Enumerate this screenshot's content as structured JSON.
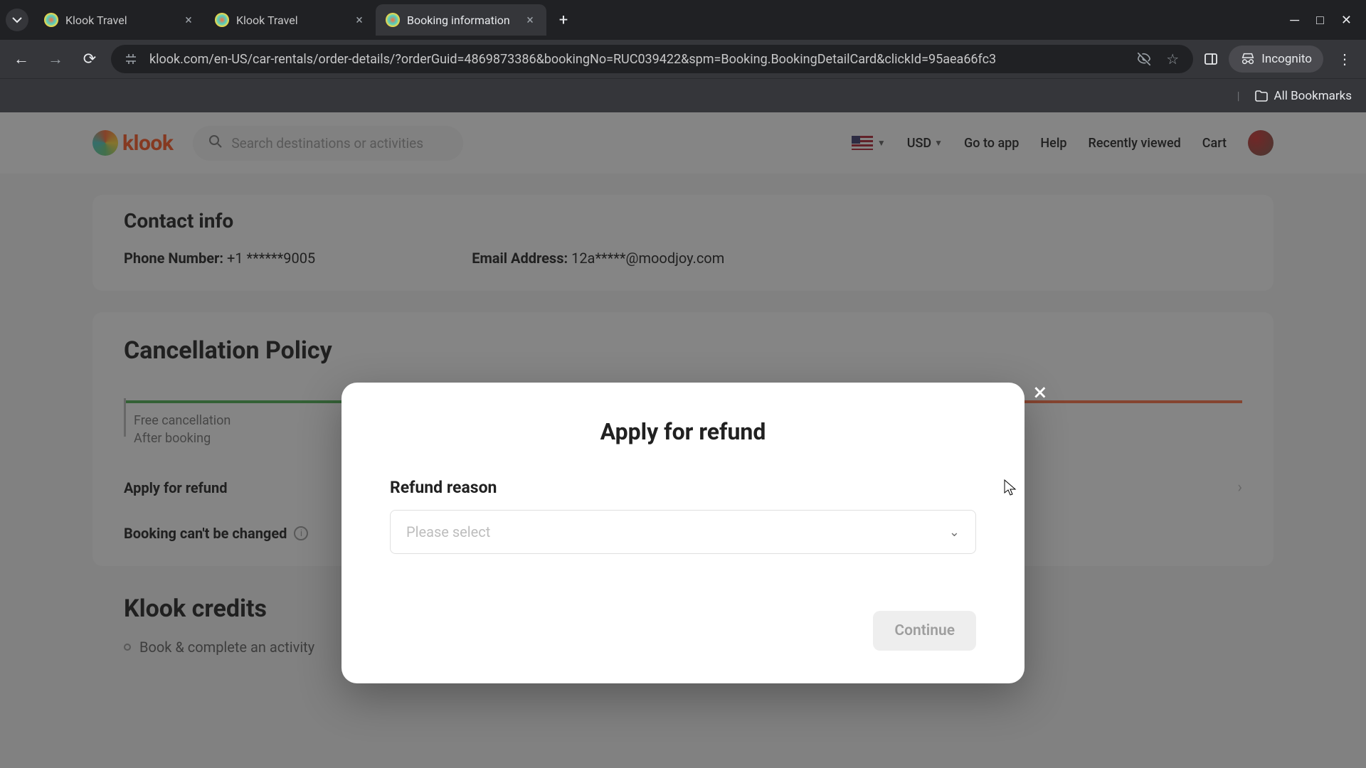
{
  "browser": {
    "tabs": [
      {
        "title": "Klook Travel",
        "active": false
      },
      {
        "title": "Klook Travel",
        "active": false
      },
      {
        "title": "Booking information",
        "active": true
      }
    ],
    "url": "klook.com/en-US/car-rentals/order-details/?orderGuid=4869873386&bookingNo=RUC039422&spm=Booking.BookingDetailCard&clickId=95aea66fc3",
    "incognito_label": "Incognito",
    "all_bookmarks": "All Bookmarks"
  },
  "header": {
    "logo_text": "klook",
    "search_placeholder": "Search destinations or activities",
    "currency": "USD",
    "links": {
      "go_to_app": "Go to app",
      "help": "Help",
      "recently_viewed": "Recently viewed",
      "cart": "Cart"
    }
  },
  "contact": {
    "title": "Contact info",
    "phone_label": "Phone Number:",
    "phone_value": "+1 ******9005",
    "email_label": "Email Address:",
    "email_value": "12a*****@moodjoy.com"
  },
  "cancellation": {
    "title": "Cancellation Policy",
    "timeline_label_line1": "Free cancellation",
    "timeline_label_line2": "After booking",
    "apply_refund": "Apply for refund",
    "cannot_change": "Booking can't be changed"
  },
  "credits": {
    "title": "Klook credits",
    "item1": "Book & complete an activity"
  },
  "modal": {
    "title": "Apply for refund",
    "field_label": "Refund reason",
    "placeholder": "Please select",
    "continue": "Continue"
  }
}
